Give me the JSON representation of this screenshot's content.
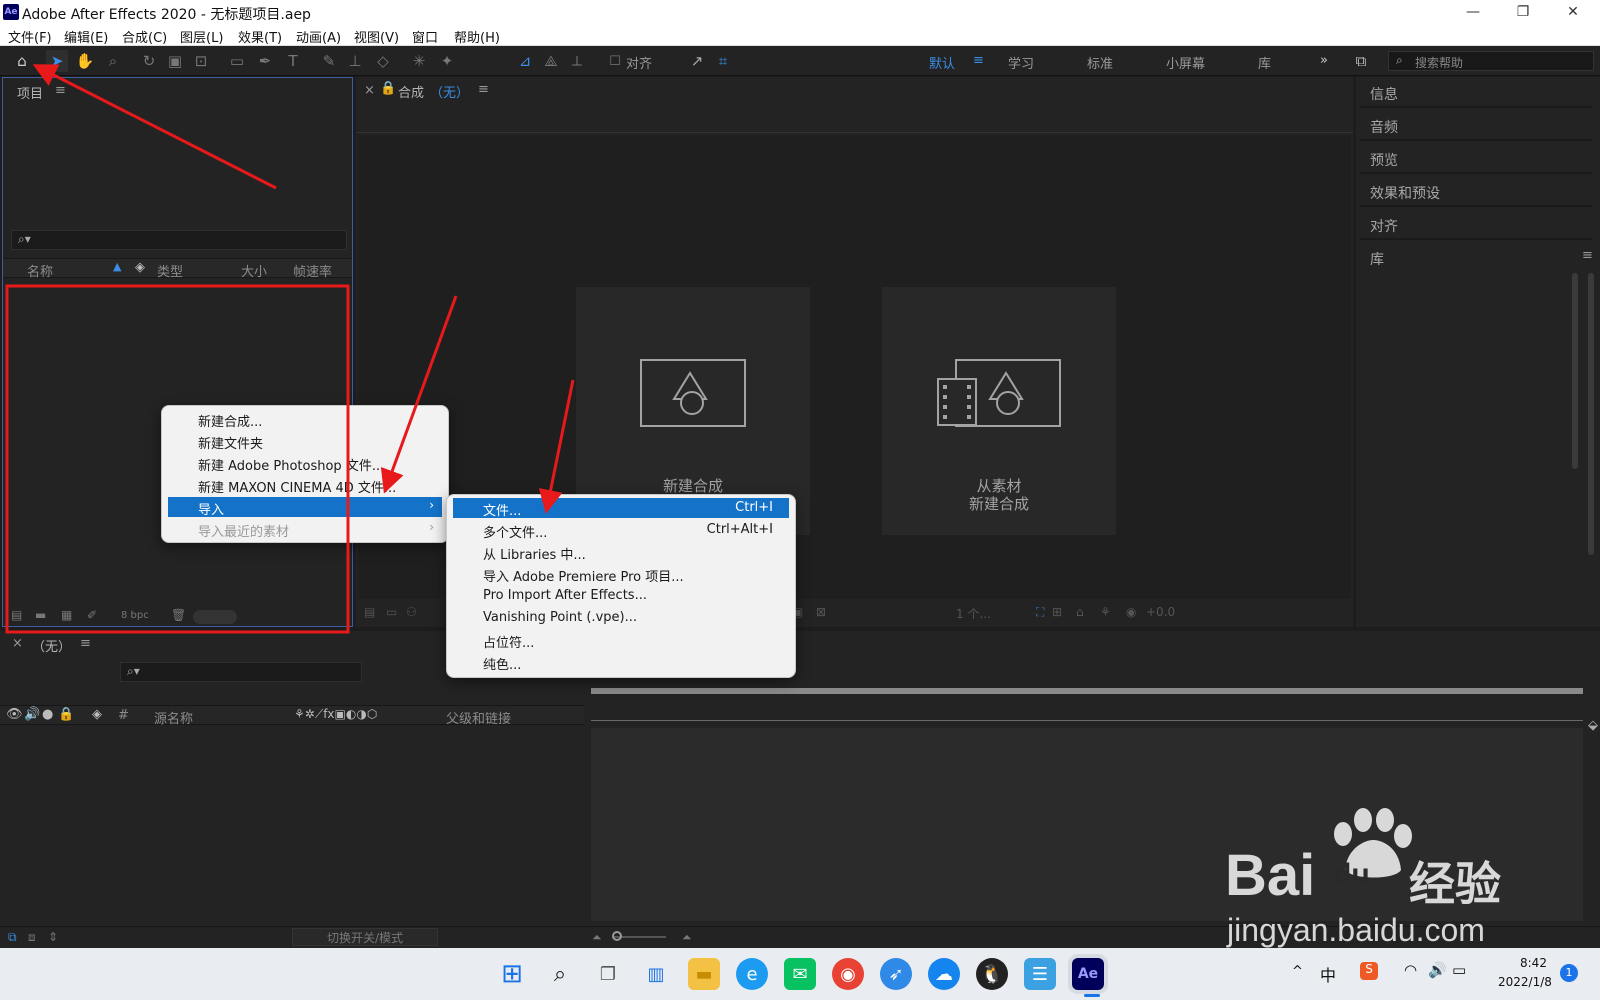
{
  "window": {
    "app_icon": "Ae",
    "title": "Adobe After Effects 2020 - 无标题项目.aep",
    "controls": [
      "minimize-icon",
      "restore-icon",
      "close-icon"
    ]
  },
  "menubar": [
    "文件(F)",
    "编辑(E)",
    "合成(C)",
    "图层(L)",
    "效果(T)",
    "动画(A)",
    "视图(V)",
    "窗口",
    "帮助(H)"
  ],
  "toolbar": {
    "align_label": "对齐",
    "workspaces": [
      "默认",
      "学习",
      "标准",
      "小屏幕",
      "库"
    ],
    "active_workspace": "默认",
    "search_placeholder": "搜索帮助"
  },
  "project_panel": {
    "title": "项目",
    "columns": [
      "名称",
      "类型",
      "大小",
      "帧速率"
    ],
    "bpc": "8 bpc"
  },
  "comp_panel": {
    "tab": "合成",
    "tab_value": "（无）",
    "cards": [
      {
        "label_lines": [
          "新建合成"
        ]
      },
      {
        "label_lines": [
          "从素材",
          "新建合成"
        ]
      }
    ],
    "footer_value": "+0.0",
    "footer_zoom": "1 个..."
  },
  "right_panel": {
    "items": [
      "信息",
      "音频",
      "预览",
      "效果和预设",
      "对齐",
      "库"
    ]
  },
  "timeline": {
    "tab": "（无）",
    "columns": [
      "#",
      "源名称",
      "父级和链接"
    ],
    "toggle_label": "切换开关/模式"
  },
  "context_menu": {
    "items": [
      "新建合成...",
      "新建文件夹",
      "新建 Adobe Photoshop 文件...",
      "新建 MAXON CINEMA 4D 文件...",
      "导入",
      "导入最近的素材"
    ]
  },
  "import_submenu": {
    "items": [
      {
        "label": "文件...",
        "shortcut": "Ctrl+I"
      },
      {
        "label": "多个文件...",
        "shortcut": "Ctrl+Alt+I"
      },
      {
        "label": "从 Libraries 中...",
        "shortcut": ""
      },
      {
        "label": "导入 Adobe Premiere Pro 项目...",
        "shortcut": ""
      },
      {
        "label": "Pro Import After Effects...",
        "shortcut": ""
      },
      {
        "label": "Vanishing Point (.vpe)...",
        "shortcut": ""
      },
      {
        "label": "占位符...",
        "shortcut": ""
      },
      {
        "label": "纯色...",
        "shortcut": ""
      }
    ]
  },
  "taskbar": {
    "ime": "中",
    "time": "8:42",
    "date": "2022/1/8",
    "notifications": "1"
  },
  "watermark": {
    "brand_left": "Bai",
    "brand_mid": "du",
    "brand_cn": "经验",
    "url": "jingyan.baidu.com"
  },
  "annotation_color": "#e8191a",
  "accent_color": "#1473c9"
}
